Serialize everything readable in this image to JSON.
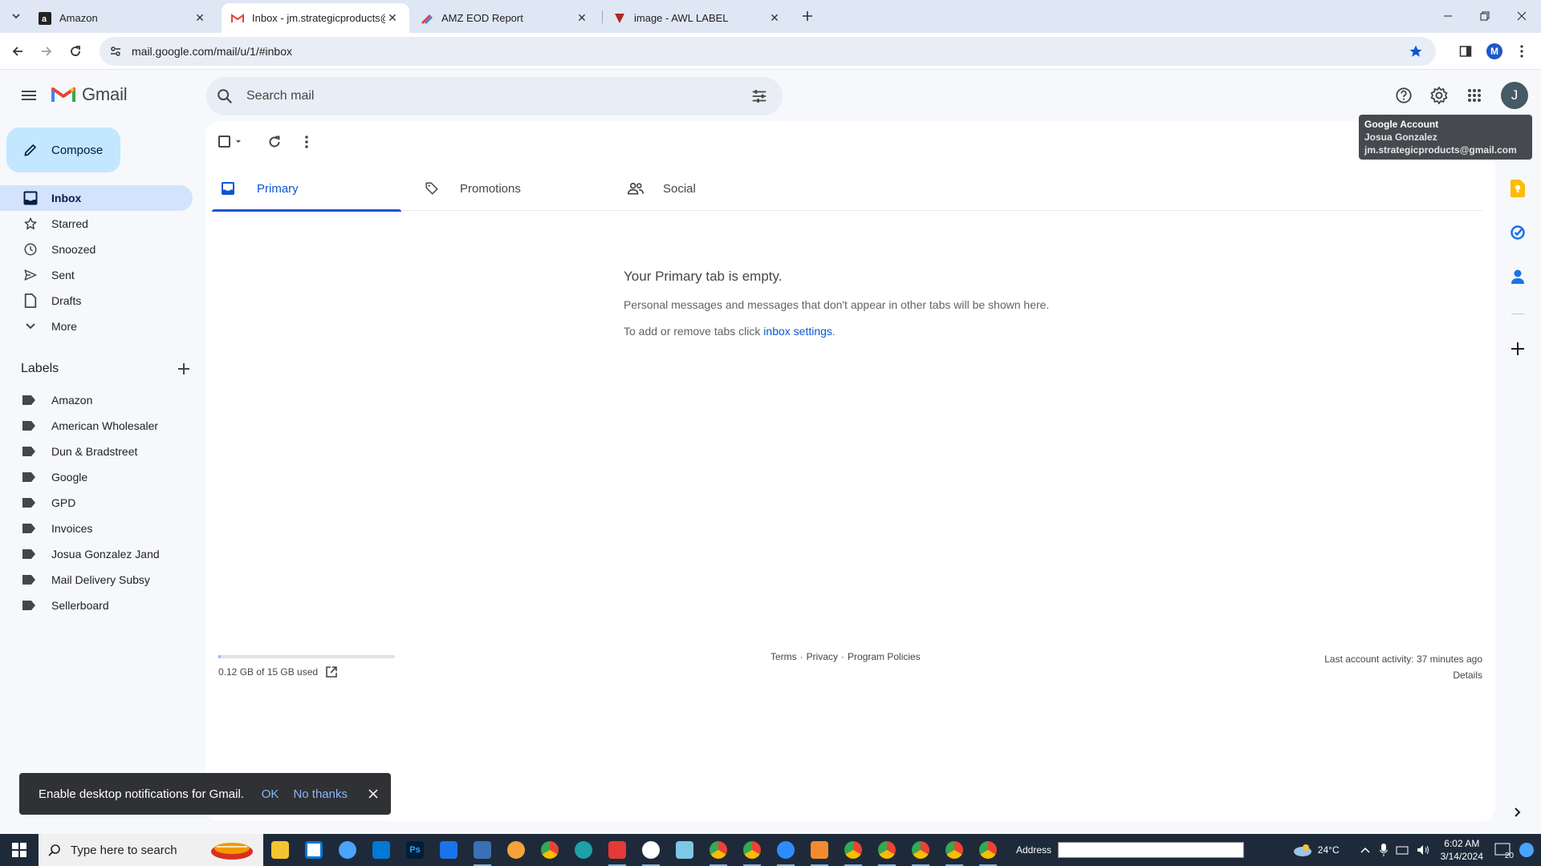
{
  "browser": {
    "tabs": [
      {
        "title": "Amazon",
        "active": false
      },
      {
        "title": "Inbox - jm.strategicproducts@g",
        "active": true
      },
      {
        "title": "AMZ EOD Report",
        "active": false
      },
      {
        "title": "image - AWL LABEL",
        "active": false
      }
    ],
    "url": "mail.google.com/mail/u/1/#inbox",
    "profile_initial": "M"
  },
  "gmail": {
    "product_name": "Gmail",
    "search_placeholder": "Search mail",
    "avatar_initial": "J",
    "tooltip": {
      "title": "Google Account",
      "name": "Josua Gonzalez",
      "email": "jm.strategicproducts@gmail.com"
    },
    "compose_label": "Compose",
    "nav": [
      {
        "label": "Inbox",
        "icon": "inbox-icon",
        "active": true
      },
      {
        "label": "Starred",
        "icon": "star-icon",
        "active": false
      },
      {
        "label": "Snoozed",
        "icon": "clock-icon",
        "active": false
      },
      {
        "label": "Sent",
        "icon": "send-icon",
        "active": false
      },
      {
        "label": "Drafts",
        "icon": "draft-icon",
        "active": false
      },
      {
        "label": "More",
        "icon": "chevron-down-icon",
        "active": false
      }
    ],
    "labels_heading": "Labels",
    "labels": [
      "Amazon",
      "American Wholesaler",
      "Dun & Bradstreet",
      "Google",
      "GPD",
      "Invoices",
      "Josua Gonzalez Jand",
      "Mail Delivery Subsy",
      "Sellerboard"
    ],
    "category_tabs": [
      {
        "label": "Primary",
        "icon": "inbox-icon",
        "active": true
      },
      {
        "label": "Promotions",
        "icon": "tag-icon",
        "active": false
      },
      {
        "label": "Social",
        "icon": "people-icon",
        "active": false
      }
    ],
    "empty_state": {
      "heading": "Your Primary tab is empty.",
      "line1": "Personal messages and messages that don't appear in other tabs will be shown here.",
      "line2_prefix": "To add or remove tabs click ",
      "line2_link": "inbox settings",
      "line2_suffix": "."
    },
    "storage": {
      "text": "0.12 GB of 15 GB used",
      "used_fraction": 0.008
    },
    "footer": {
      "terms": "Terms",
      "sep": "·",
      "privacy": "Privacy",
      "policies": "Program Policies"
    },
    "activity": {
      "text": "Last account activity: 37 minutes ago",
      "details": "Details"
    },
    "snackbar": {
      "message": "Enable desktop notifications for Gmail.",
      "ok": "OK",
      "no_thanks": "No thanks"
    }
  },
  "taskbar": {
    "search_placeholder": "Type here to search",
    "address_label": "Address",
    "temperature": "24°C",
    "time": "6:02 AM",
    "date": "3/14/2024",
    "notification_count": "20"
  },
  "colors": {
    "accent": "#0b57d0",
    "compose_bg": "#c2e7ff",
    "active_nav_bg": "#d3e3fd",
    "app_bg": "#f6f8fc"
  }
}
